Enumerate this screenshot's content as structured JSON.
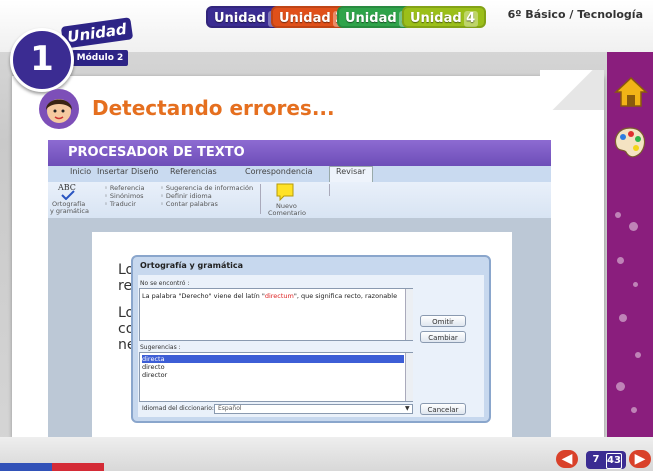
{
  "header": {
    "units": [
      {
        "label": "Unidad",
        "num": "1",
        "color": "#3b2c92"
      },
      {
        "label": "Unidad",
        "num": "2",
        "color": "#e0501a"
      },
      {
        "label": "Unidad",
        "num": "3",
        "color": "#2fa34a"
      },
      {
        "label": "Unidad",
        "num": "4",
        "color": "#9bbf1a"
      }
    ],
    "grade": "6º Básico / Tecnología"
  },
  "badge": {
    "number": "1",
    "unidad": "Unidad",
    "modulo": "Módulo 2"
  },
  "lesson": {
    "title": "Detectando errores..."
  },
  "app": {
    "title": "PROCESADOR DE TEXTO",
    "tabs": [
      "Inicio",
      "Insertar",
      "Diseño",
      "Referencias",
      "Correspondencia",
      "Revisar"
    ],
    "ribbon": {
      "abc": "ABC",
      "spell_label_1": "Ortografía",
      "spell_label_2": "y gramática",
      "col1": [
        "Referencia",
        "Sinónimos",
        "Traducir"
      ],
      "col2": [
        "Sugerencia de información",
        "Definir idioma",
        "Contar palabras"
      ],
      "new_comment_1": "Nuevo",
      "new_comment_2": "Comentario"
    },
    "doc_letters": [
      "Lo",
      "re",
      "Lo",
      "co",
      "ne"
    ]
  },
  "dialog": {
    "title": "Ortografía y gramática",
    "not_found_label": "No se encontró :",
    "sentence_before": "La palabra \"Derecho\" viene del latín \"",
    "sentence_error": "directum",
    "sentence_after": "\", que significa recto, razonable",
    "omit_button": "Omitir",
    "change_button": "Cambiar",
    "suggestions_label": "Sugerencias :",
    "suggestions": [
      "directa",
      "directo",
      "director"
    ],
    "language_label": "Idiomad del diccionario:",
    "language_value": "Español",
    "cancel_button": "Cancelar"
  },
  "footer": {
    "current_page": "7",
    "total_pages": "43",
    "prev": "◀",
    "next": "▶"
  }
}
